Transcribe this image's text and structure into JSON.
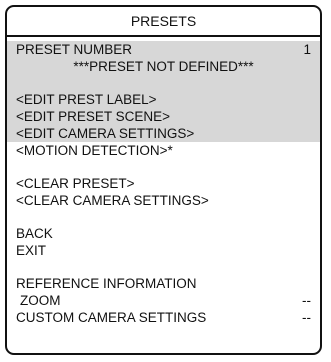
{
  "title": "PRESETS",
  "preset_number": {
    "label": "PRESET NUMBER",
    "value": "1"
  },
  "preset_status": "***PRESET NOT DEFINED***",
  "edit_items": {
    "label": "<EDIT PREST LABEL>",
    "scene": "<EDIT PRESET SCENE>",
    "camera": "<EDIT CAMERA SETTINGS>",
    "motion": "<MOTION DETECTION>*"
  },
  "clear_items": {
    "preset": "<CLEAR PRESET>",
    "camera": "<CLEAR CAMERA SETTINGS>"
  },
  "nav": {
    "back": "BACK",
    "exit": "EXIT"
  },
  "reference": {
    "heading": "REFERENCE INFORMATION",
    "zoom_label": "ZOOM",
    "zoom_value": "--",
    "custom_label": "CUSTOM CAMERA SETTINGS",
    "custom_value": "--"
  },
  "colors": {
    "highlight": "#d7d7d7",
    "border": "#111111"
  }
}
